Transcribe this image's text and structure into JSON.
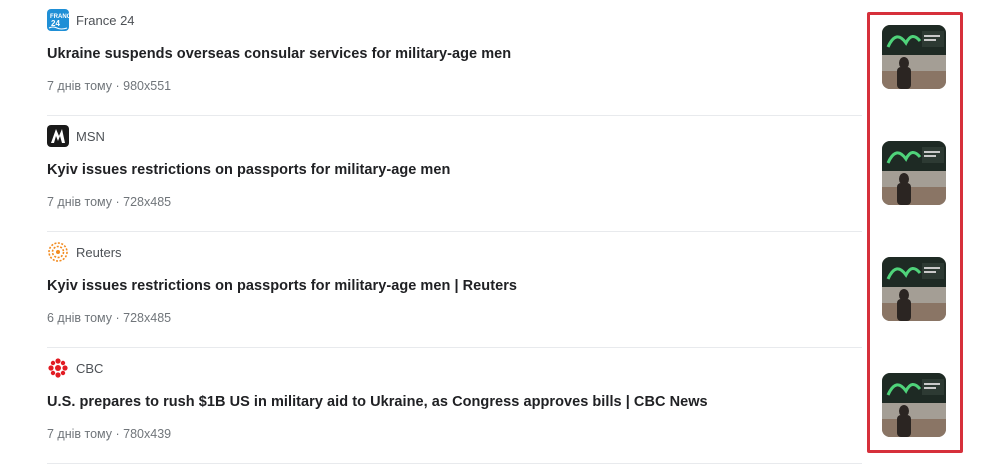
{
  "results": [
    {
      "source": "France 24",
      "title": "Ukraine suspends overseas consular services for military-age men",
      "meta": "7 днів тому · 980x551",
      "logo_icon": "france24-logo-icon",
      "logo_color": "#1f8fd6"
    },
    {
      "source": "MSN",
      "title": "Kyiv issues restrictions on passports for military-age men",
      "meta": "7 днів тому · 728x485",
      "logo_icon": "msn-logo-icon",
      "logo_color": "#1a1a1a"
    },
    {
      "source": "Reuters",
      "title": "Kyiv issues restrictions on passports for military-age men | Reuters",
      "meta": "6 днів тому · 728x485",
      "logo_icon": "reuters-logo-icon",
      "logo_color": "#f28b20"
    },
    {
      "source": "CBC",
      "title": "U.S. prepares to rush $1B US in military aid to Ukraine, as Congress approves bills | CBC News",
      "meta": "7 днів тому · 780x439",
      "logo_icon": "cbc-logo-icon",
      "logo_color": "#e21b22"
    }
  ],
  "colors": {
    "highlight_border": "#d6303b",
    "divider": "#e8eaed",
    "meta_text": "#70757a"
  }
}
